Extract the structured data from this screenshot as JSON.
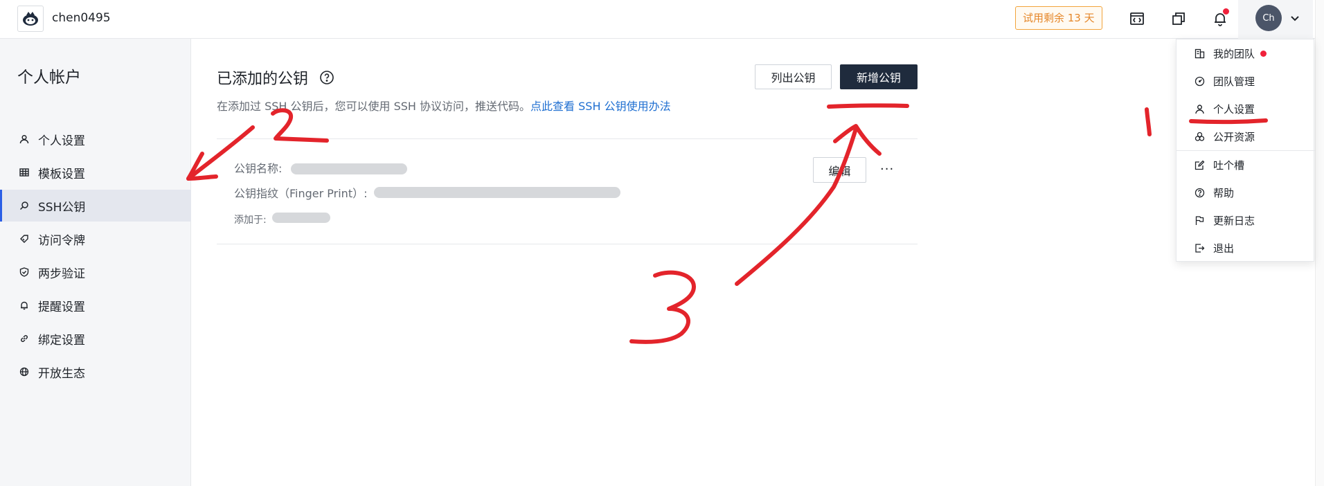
{
  "header": {
    "username": "chen0495",
    "trial_badge": "试用剩余 13 天",
    "avatar_initials": "Ch"
  },
  "sidebar": {
    "title": "个人帐户",
    "items": [
      {
        "label": "个人设置",
        "icon": "user-icon"
      },
      {
        "label": "模板设置",
        "icon": "grid-icon"
      },
      {
        "label": "SSH公钥",
        "icon": "search-key-icon",
        "active": true
      },
      {
        "label": "访问令牌",
        "icon": "ticket-icon"
      },
      {
        "label": "两步验证",
        "icon": "shield-icon"
      },
      {
        "label": "提醒设置",
        "icon": "bell-icon"
      },
      {
        "label": "绑定设置",
        "icon": "link-icon"
      },
      {
        "label": "开放生态",
        "icon": "globe-icon"
      }
    ]
  },
  "main": {
    "title": "已添加的公钥",
    "subtitle_text": "在添加过 SSH 公钥后，您可以使用 SSH 协议访问，推送代码。",
    "subtitle_link": "点此查看 SSH 公钥使用办法",
    "list_button": "列出公钥",
    "add_button": "新增公钥",
    "key": {
      "name_label": "公钥名称:",
      "fingerprint_label": "公钥指纹（Finger Print）:",
      "added_label": "添加于:",
      "edit_button": "编辑",
      "more_button": "···"
    }
  },
  "dropdown": {
    "items": [
      {
        "label": "我的团队",
        "icon": "team-icon",
        "dot": true
      },
      {
        "label": "团队管理",
        "icon": "dashboard-icon"
      },
      {
        "label": "个人设置",
        "icon": "user-icon"
      },
      {
        "label": "公开资源",
        "icon": "resources-icon"
      },
      {
        "label": "吐个槽",
        "icon": "feedback-icon"
      },
      {
        "label": "帮助",
        "icon": "help-icon"
      },
      {
        "label": "更新日志",
        "icon": "flag-icon"
      },
      {
        "label": "退出",
        "icon": "logout-icon"
      }
    ]
  },
  "colors": {
    "accent": "#2b5fe6",
    "primary_button": "#1f2b3d",
    "annotation_red": "#e3242b",
    "trial_orange": "#e5872a"
  }
}
